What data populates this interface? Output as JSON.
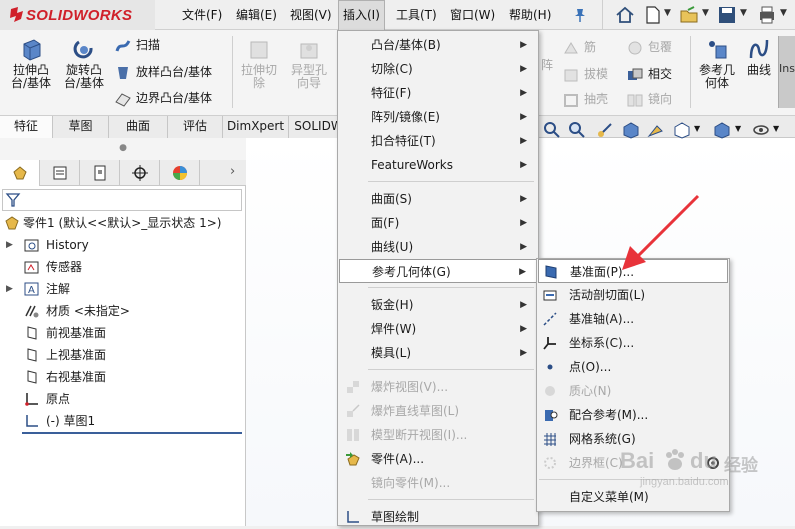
{
  "app": {
    "name": "SOLIDWORKS"
  },
  "menubar": {
    "items": [
      "文件(F)",
      "编辑(E)",
      "视图(V)",
      "插入(I)",
      "工具(T)",
      "窗口(W)",
      "帮助(H)"
    ]
  },
  "command_manager": {
    "extrude_boss": "拉伸凸\n台/基体",
    "revolve_boss": "旋转凸\n台/基体",
    "sweep": "扫描",
    "loft": "放样凸台/基体",
    "boundary": "边界凸台/基体",
    "extrude_cut": "拉伸切\n除",
    "hole_wizard": "异型孔\n向导",
    "array_partial": "阵",
    "rib": "筋",
    "draft": "拔模",
    "shell": "抽壳",
    "wrap": "包覆",
    "intersect": "相交",
    "mirror": "镜向",
    "ref_geometry": "参考几\n何体",
    "curves": "曲线",
    "instant": "Ins"
  },
  "tabs": [
    "特征",
    "草图",
    "曲面",
    "评估",
    "DimXpert",
    "SOLIDW"
  ],
  "feature_tree": {
    "part": "零件1  (默认<<默认>_显示状态 1>)",
    "items": [
      "History",
      "传感器",
      "注解",
      "材质 <未指定>",
      "前视基准面",
      "上视基准面",
      "右视基准面",
      "原点",
      "(-) 草图1"
    ]
  },
  "insert_menu": {
    "items": [
      {
        "label": "凸台/基体(B)",
        "submenu": true
      },
      {
        "label": "切除(C)",
        "submenu": true
      },
      {
        "label": "特征(F)",
        "submenu": true
      },
      {
        "label": "阵列/镜像(E)",
        "submenu": true
      },
      {
        "label": "扣合特征(T)",
        "submenu": true
      },
      {
        "label": "FeatureWorks",
        "submenu": true
      },
      {
        "label": "曲面(S)",
        "submenu": true
      },
      {
        "label": "面(F)",
        "submenu": true
      },
      {
        "label": "曲线(U)",
        "submenu": true
      },
      {
        "label": "参考几何体(G)",
        "submenu": true
      },
      {
        "label": "钣金(H)",
        "submenu": true
      },
      {
        "label": "焊件(W)",
        "submenu": true
      },
      {
        "label": "模具(L)",
        "submenu": true
      },
      {
        "label": "爆炸视图(V)..."
      },
      {
        "label": "爆炸直线草图(L)"
      },
      {
        "label": "模型断开视图(I)..."
      },
      {
        "label": "零件(A)..."
      },
      {
        "label": "镜向零件(M)..."
      },
      {
        "label": "草图绘制"
      }
    ]
  },
  "ref_geometry_submenu": {
    "items": [
      "基准面(P)...",
      "活动剖切面(L)",
      "基准轴(A)...",
      "坐标系(C)...",
      "点(O)...",
      "质心(N)",
      "配合参考(M)...",
      "网格系统(G)",
      "边界框(C)",
      "自定义菜单(M)"
    ]
  },
  "watermark": {
    "brand": "Bai",
    "brand_accent": "du",
    "sub": "经验",
    "url": "jingyan.baidu.com"
  },
  "colors": {
    "brand_red": "#d0202a",
    "arrow_red": "#e8333a",
    "menu_bg": "#f2f2f2",
    "hl_border": "#9a9a9a"
  }
}
